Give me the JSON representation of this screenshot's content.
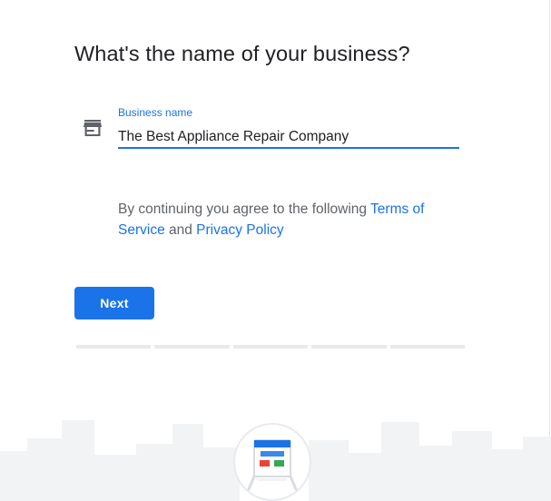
{
  "page": {
    "heading": "What's the name of your business?"
  },
  "field": {
    "icon": "store-icon",
    "label": "Business name",
    "value": "The Best Appliance Repair Company"
  },
  "terms": {
    "prefix": "By continuing you agree to the following ",
    "terms_link": "Terms of Service",
    "conjunction": " and ",
    "privacy_link": "Privacy Policy"
  },
  "actions": {
    "next_label": "Next"
  },
  "progress": {
    "total_steps": 5,
    "completed_steps": 0
  },
  "colors": {
    "accent": "#1a73e8",
    "heading_text": "#202124",
    "body_text": "#5f6368",
    "progress_track": "#e8eaed"
  },
  "illustration": {
    "icon": "storefront-illustration-icon"
  }
}
